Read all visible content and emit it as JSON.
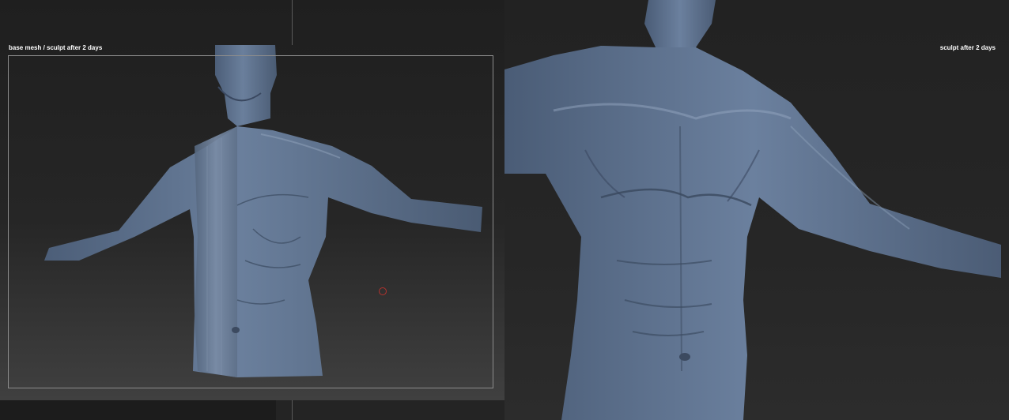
{
  "labels": {
    "left": "base mesh / sculpt after 2 days",
    "right": "sculpt after 2 days"
  },
  "colors": {
    "background": "#232323",
    "skin": "#5d7290",
    "skin_dark": "#3f4f66",
    "skin_light": "#8397b2",
    "frame": "#8c8c8c",
    "cursor": "#b3332e"
  }
}
